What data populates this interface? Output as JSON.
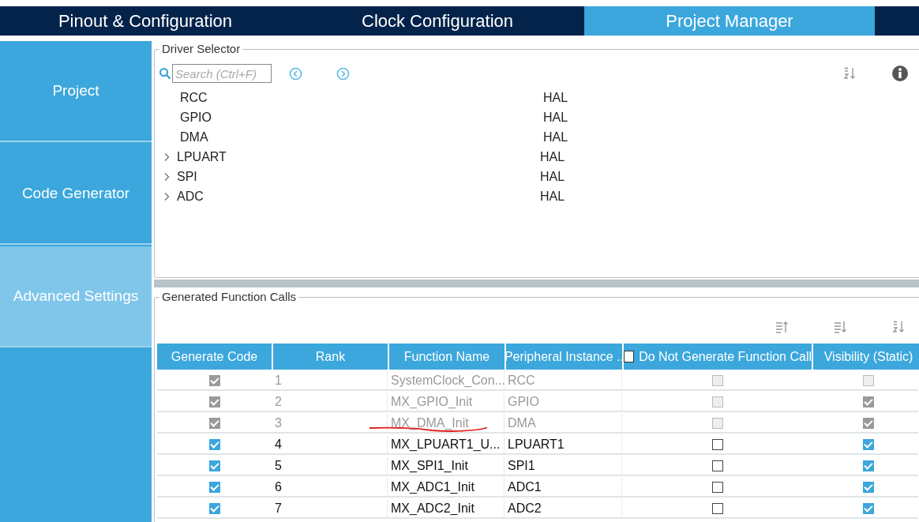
{
  "tabs": [
    {
      "label": "Pinout & Configuration",
      "selected": false
    },
    {
      "label": "Clock Configuration",
      "selected": false
    },
    {
      "label": "Project Manager",
      "selected": true
    }
  ],
  "sidebar": {
    "items": [
      {
        "label": "Project",
        "selected": false
      },
      {
        "label": "Code Generator",
        "selected": false
      },
      {
        "label": "Advanced Settings",
        "selected": true
      }
    ]
  },
  "driver_selector": {
    "title": "Driver Selector",
    "search": {
      "placeholder": "Search (Ctrl+F)"
    },
    "rows": [
      {
        "name": "RCC",
        "driver": "HAL",
        "expandable": false
      },
      {
        "name": "GPIO",
        "driver": "HAL",
        "expandable": false
      },
      {
        "name": "DMA",
        "driver": "HAL",
        "expandable": false
      },
      {
        "name": "LPUART",
        "driver": "HAL",
        "expandable": true
      },
      {
        "name": "SPI",
        "driver": "HAL",
        "expandable": true
      },
      {
        "name": "ADC",
        "driver": "HAL",
        "expandable": true
      }
    ]
  },
  "generated_calls": {
    "title": "Generated Function Calls",
    "columns": [
      "Generate Code",
      "Rank",
      "Function Name",
      "Peripheral Instance ..",
      "Do Not Generate Function Call",
      "Visibility (Static)"
    ],
    "header_checkbox": {
      "checked": false
    },
    "rows": [
      {
        "generate": {
          "checked": true,
          "disabled": true
        },
        "rank": "1",
        "function": "SystemClock_Con...",
        "instance": "RCC",
        "no_generate": {
          "checked": false,
          "disabled": true
        },
        "visibility": {
          "checked": false,
          "disabled": true
        },
        "disabled": true
      },
      {
        "generate": {
          "checked": true,
          "disabled": true
        },
        "rank": "2",
        "function": "MX_GPIO_Init",
        "instance": "GPIO",
        "no_generate": {
          "checked": false,
          "disabled": true
        },
        "visibility": {
          "checked": true,
          "disabled": true
        },
        "disabled": true
      },
      {
        "generate": {
          "checked": true,
          "disabled": true
        },
        "rank": "3",
        "function": "MX_DMA_Init",
        "instance": "DMA",
        "no_generate": {
          "checked": false,
          "disabled": true
        },
        "visibility": {
          "checked": true,
          "disabled": true
        },
        "disabled": true
      },
      {
        "generate": {
          "checked": true,
          "disabled": false
        },
        "rank": "4",
        "function": "MX_LPUART1_U...",
        "instance": "LPUART1",
        "no_generate": {
          "checked": false,
          "disabled": false
        },
        "visibility": {
          "checked": true,
          "disabled": false
        },
        "disabled": false
      },
      {
        "generate": {
          "checked": true,
          "disabled": false
        },
        "rank": "5",
        "function": "MX_SPI1_Init",
        "instance": "SPI1",
        "no_generate": {
          "checked": false,
          "disabled": false
        },
        "visibility": {
          "checked": true,
          "disabled": false
        },
        "disabled": false
      },
      {
        "generate": {
          "checked": true,
          "disabled": false
        },
        "rank": "6",
        "function": "MX_ADC1_Init",
        "instance": "ADC1",
        "no_generate": {
          "checked": false,
          "disabled": false
        },
        "visibility": {
          "checked": true,
          "disabled": false
        },
        "disabled": false
      },
      {
        "generate": {
          "checked": true,
          "disabled": false
        },
        "rank": "7",
        "function": "MX_ADC2_Init",
        "instance": "ADC2",
        "no_generate": {
          "checked": false,
          "disabled": false
        },
        "visibility": {
          "checked": true,
          "disabled": false
        },
        "disabled": false
      }
    ]
  }
}
